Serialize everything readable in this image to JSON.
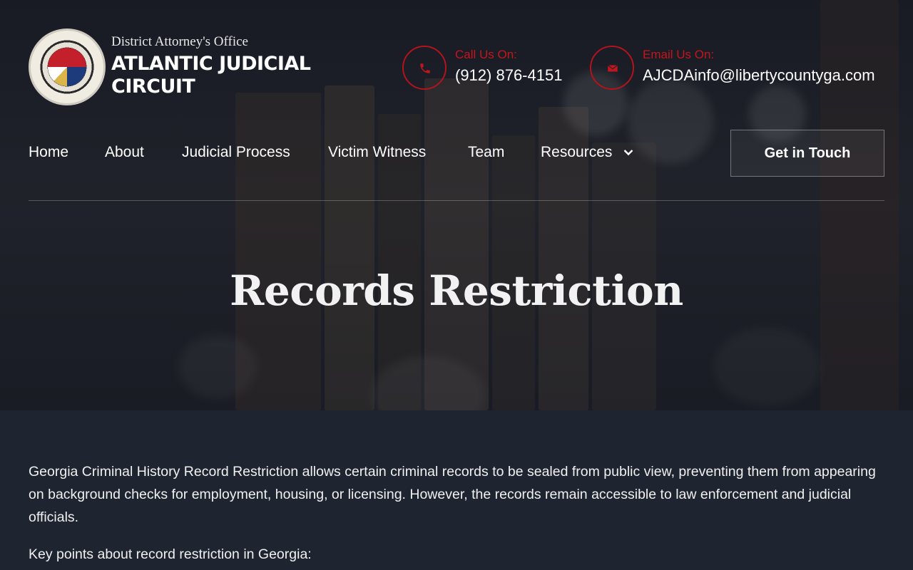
{
  "brand": {
    "subtitle": "District Attorney's Office",
    "title": "ATLANTIC JUDICIAL CIRCUIT",
    "logo_icon": "district-attorney-seal"
  },
  "contacts": {
    "phone": {
      "label": "Call Us On:",
      "value": "(912) 876-4151",
      "icon": "phone-icon"
    },
    "email": {
      "label": "Email Us On:",
      "value": "AJCDAinfo@libertycountyga.com",
      "icon": "mail-icon"
    }
  },
  "nav": {
    "items": [
      "Home",
      "About",
      "Judicial Process",
      "Victim Witness",
      "Team",
      "Resources"
    ],
    "cta": "Get in Touch"
  },
  "hero": {
    "title": "Records Restriction"
  },
  "content": {
    "intro": "Georgia Criminal History Record Restriction allows certain criminal records to be sealed from public view, preventing them from appearing on background checks for employment, housing, or licensing. However, the records remain accessible to law enforcement and judicial officials.",
    "key_points_heading": "Key points about record restriction in Georgia:"
  },
  "colors": {
    "accent_red": "#c4151c",
    "page_bg": "#1f2530"
  }
}
